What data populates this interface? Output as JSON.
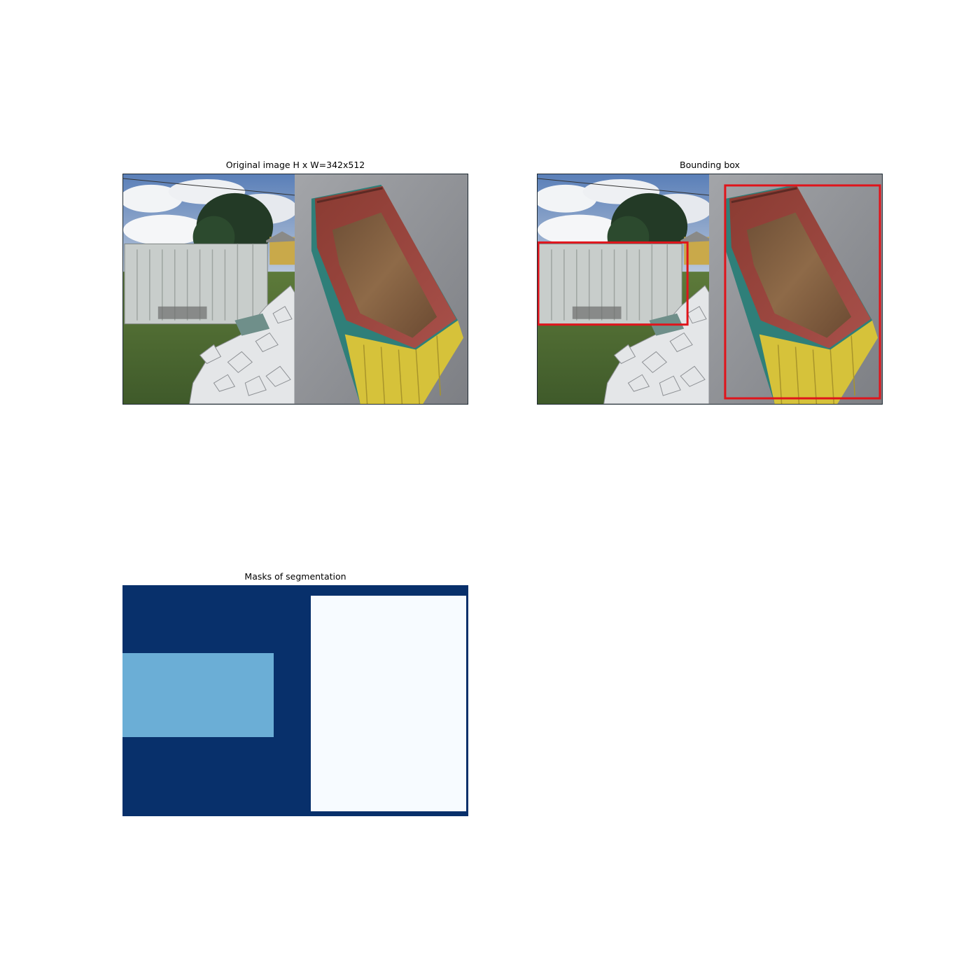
{
  "panels": {
    "original": {
      "title": "Original image H x W=342x512"
    },
    "bbox": {
      "title": "Bounding box"
    },
    "masks": {
      "title": "Masks of segmentation"
    }
  },
  "colors": {
    "box_stroke": "#e0141b",
    "mask_background": "#08306b",
    "mask_object_1": "#6baed6",
    "mask_object_2": "#f7fbff"
  }
}
